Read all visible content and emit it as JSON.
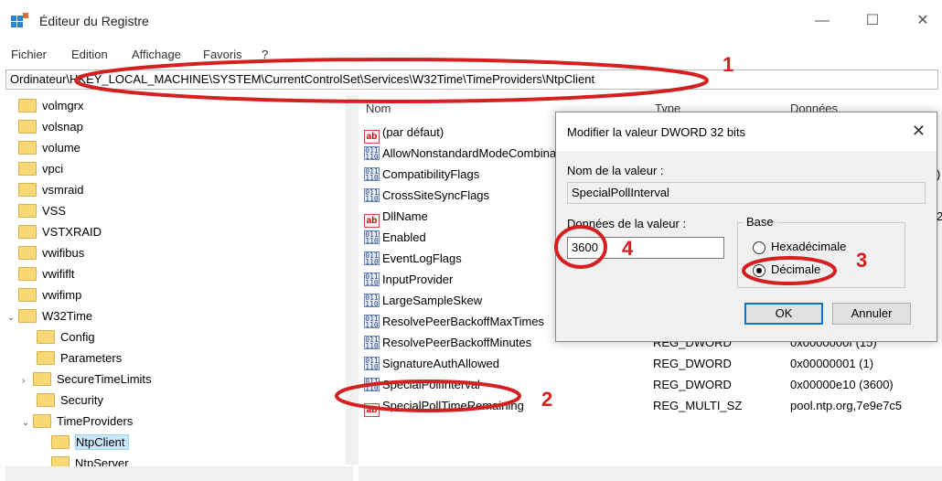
{
  "window": {
    "title": "Éditeur du Registre",
    "minimize": "—",
    "maximize": "☐",
    "close": "✕"
  },
  "menu": [
    "Fichier",
    "Edition",
    "Affichage",
    "Favoris",
    "?"
  ],
  "address": "Ordinateur\\HKEY_LOCAL_MACHINE\\SYSTEM\\CurrentControlSet\\Services\\W32Time\\TimeProviders\\NtpClient",
  "tree": [
    "volmgrx",
    "volsnap",
    "volume",
    "vpci",
    "vsmraid",
    "VSS",
    "VSTXRAID",
    "vwifibus",
    "vwififlt",
    "vwifimp",
    "W32Time",
    "Config",
    "Parameters",
    "SecureTimeLimits",
    "Security",
    "TimeProviders",
    "NtpClient",
    "NtpServer"
  ],
  "list": {
    "headers": {
      "name": "Nom",
      "type": "Type",
      "data": "Données"
    },
    "rows": [
      {
        "name": "(par défaut)",
        "icon": "string-value-icon",
        "type": "",
        "data": ""
      },
      {
        "name": "AllowNonstandardModeCombinations",
        "icon": "binary-value-icon",
        "type": "",
        "data": ""
      },
      {
        "name": "CompatibilityFlags",
        "icon": "binary-value-icon",
        "type": "",
        "data": ")"
      },
      {
        "name": "CrossSiteSyncFlags",
        "icon": "binary-value-icon",
        "type": "",
        "data": ""
      },
      {
        "name": "DllName",
        "icon": "string-value-icon",
        "type": "",
        "data": "2"
      },
      {
        "name": "Enabled",
        "icon": "binary-value-icon",
        "type": "",
        "data": ""
      },
      {
        "name": "EventLogFlags",
        "icon": "binary-value-icon",
        "type": "",
        "data": ""
      },
      {
        "name": "InputProvider",
        "icon": "binary-value-icon",
        "type": "",
        "data": ""
      },
      {
        "name": "LargeSampleSkew",
        "icon": "binary-value-icon",
        "type": "",
        "data": ""
      },
      {
        "name": "ResolvePeerBackoffMaxTimes",
        "icon": "binary-value-icon",
        "type": "",
        "data": ""
      },
      {
        "name": "ResolvePeerBackoffMinutes",
        "icon": "binary-value-icon",
        "type": "REG_DWORD",
        "data": "0x0000000f (15)"
      },
      {
        "name": "SignatureAuthAllowed",
        "icon": "binary-value-icon",
        "type": "REG_DWORD",
        "data": "0x00000001 (1)"
      },
      {
        "name": "SpecialPollInterval",
        "icon": "binary-value-icon",
        "type": "REG_DWORD",
        "data": "0x00000e10 (3600)"
      },
      {
        "name": "SpecialPollTimeRemaining",
        "icon": "string-value-icon",
        "type": "REG_MULTI_SZ",
        "data": "pool.ntp.org,7e9e7c5"
      }
    ]
  },
  "dialog": {
    "title": "Modifier la valeur DWORD 32 bits",
    "name_label": "Nom de la valeur :",
    "name_value": "SpecialPollInterval",
    "data_label": "Données de la valeur :",
    "data_value": "3600",
    "base_label": "Base",
    "hex_label": "Hexadécimale",
    "dec_label": "Décimale",
    "ok": "OK",
    "cancel": "Annuler",
    "selected_base": "Décimale"
  },
  "annotations": {
    "n1": "1",
    "n2": "2",
    "n3": "3",
    "n4": "4",
    "color": "#d42020"
  }
}
